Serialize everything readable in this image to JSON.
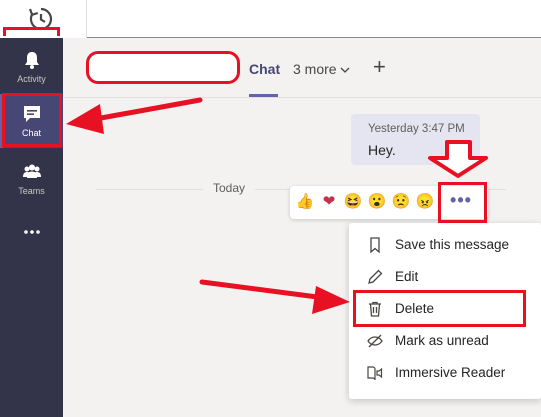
{
  "rail": {
    "items": [
      {
        "label": "Activity",
        "icon": "bell-icon"
      },
      {
        "label": "Chat",
        "icon": "chat-icon",
        "active": true
      },
      {
        "label": "Teams",
        "icon": "teams-icon"
      },
      {
        "label": "",
        "icon": "more-horizontal-icon"
      }
    ]
  },
  "header": {
    "tab_chat": "Chat",
    "tab_more": "3 more",
    "add_tab": "+"
  },
  "chat": {
    "divider_label": "Today",
    "message": {
      "timestamp": "Yesterday 3:47 PM",
      "text": "Hey."
    },
    "reactions": [
      "👍",
      "❤",
      "😆",
      "😮",
      "😟",
      "😠"
    ],
    "more_options": "•••"
  },
  "context_menu": {
    "items": [
      {
        "label": "Save this message",
        "icon": "bookmark-icon"
      },
      {
        "label": "Edit",
        "icon": "pencil-icon"
      },
      {
        "label": "Delete",
        "icon": "trash-icon"
      },
      {
        "label": "Mark as unread",
        "icon": "mark-unread-icon"
      },
      {
        "label": "Immersive Reader",
        "icon": "immersive-reader-icon"
      }
    ]
  },
  "colors": {
    "rail_bg": "#33344a",
    "accent": "#6264a7",
    "annotation_red": "#e81123"
  }
}
